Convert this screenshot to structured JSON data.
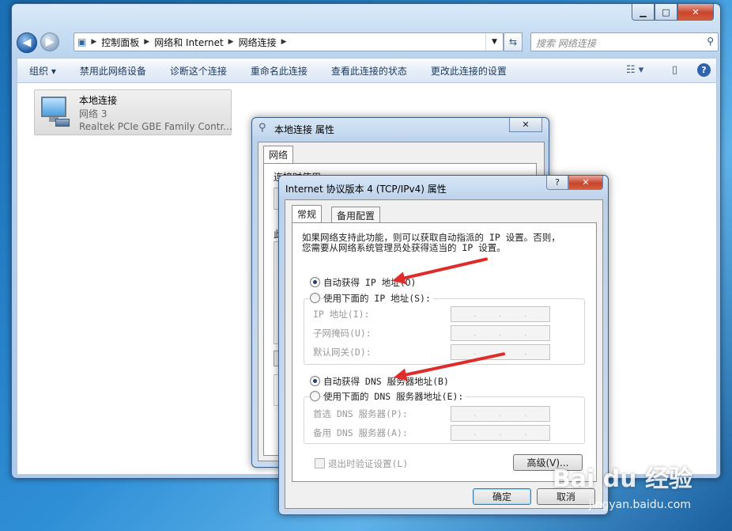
{
  "explorer": {
    "breadcrumbs": [
      "控制面板",
      "网络和 Internet",
      "网络连接"
    ],
    "search_placeholder": "搜索 网络连接",
    "toolbar": {
      "organize": "组织",
      "disable": "禁用此网络设备",
      "diagnose": "诊断这个连接",
      "rename": "重命名此连接",
      "view_status": "查看此连接的状态",
      "change_settings": "更改此连接的设置"
    },
    "connection": {
      "name": "本地连接",
      "network": "网络  3",
      "adapter": "Realtek PCIe GBE Family Contr..."
    }
  },
  "props_dialog": {
    "title": "本地连接 属性",
    "tab": "网络",
    "connect_using_partial": "连接时使用:",
    "partial_label": "此"
  },
  "ipv4_dialog": {
    "title": "Internet 协议版本 4 (TCP/IPv4) 属性",
    "tabs": [
      "常规",
      "备用配置"
    ],
    "description_line1": "如果网络支持此功能，则可以获取自动指派的 IP 设置。否则，",
    "description_line2": "您需要从网络系统管理员处获得适当的 IP 设置。",
    "auto_ip": "自动获得 IP 地址(O)",
    "manual_ip": "使用下面的 IP 地址(S):",
    "ip_address": "IP 地址(I):",
    "subnet_mask": "子网掩码(U):",
    "default_gateway": "默认网关(D):",
    "auto_dns": "自动获得 DNS 服务器地址(B)",
    "manual_dns": "使用下面的 DNS 服务器地址(E):",
    "preferred_dns": "首选 DNS 服务器(P):",
    "alternate_dns": "备用 DNS 服务器(A):",
    "validate_on_exit": "退出时验证设置(L)",
    "advanced": "高级(V)...",
    "ok": "确定",
    "cancel": "取消",
    "auto_ip_selected": true,
    "auto_dns_selected": true
  },
  "watermark": {
    "brand": "Bai du 经验",
    "url": "jingyan.baidu.com"
  }
}
